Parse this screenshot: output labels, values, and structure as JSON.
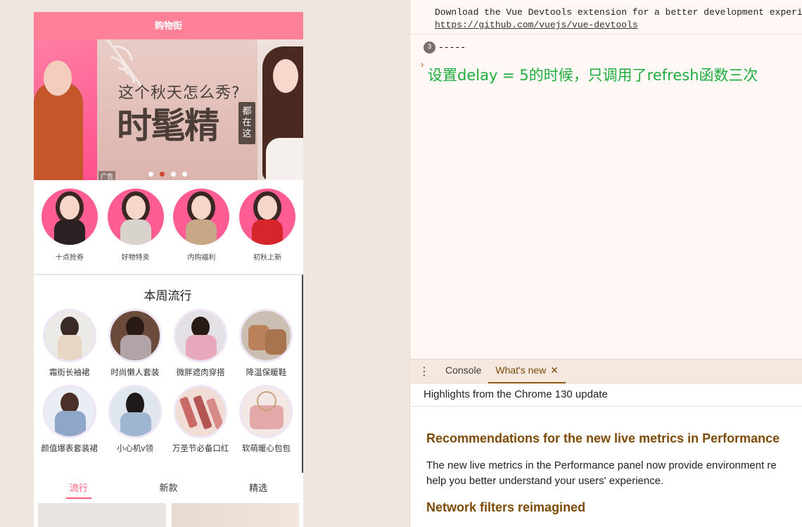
{
  "app": {
    "navbar_title": "购物街",
    "banner": {
      "subtitle": "这个秋天怎么秀?",
      "headline": "时髦精",
      "side_tag": "都在这",
      "ad_label": "广告",
      "active_dot": 2,
      "dot_count": 4
    },
    "recommend": [
      {
        "label": "十点抢券",
        "body": "#2a2222"
      },
      {
        "label": "好物特卖",
        "body": "#d9d3cd"
      },
      {
        "label": "内购福利",
        "body": "#c7a786"
      },
      {
        "label": "初秋上新",
        "body": "#d6262b"
      }
    ],
    "weekly": {
      "title": "本周流行",
      "items": [
        {
          "label": "霜街长袖裙",
          "bg": "#eceae6",
          "fg": "#e8d6c4"
        },
        {
          "label": "时尚懒人套装",
          "bg": "#6a4a3a",
          "fg": "#b2a3a8"
        },
        {
          "label": "微胖遮肉穿搭",
          "bg": "#e3e1e6",
          "fg": "#e7a8bc"
        },
        {
          "label": "降温保暖鞋",
          "bg": "#cbbeb3",
          "fg": "#b9825a"
        },
        {
          "label": "颜值爆表套装裙",
          "bg": "#e9eef4",
          "fg": "#8fa6c9"
        },
        {
          "label": "小心机v领",
          "bg": "#dfe6ee",
          "fg": "#9fb6d1"
        },
        {
          "label": "万圣节必备口红",
          "bg": "#f1dcd6",
          "fg": "#c96a67"
        },
        {
          "label": "软萌暖心包包",
          "bg": "#f3e8e6",
          "fg": "#e3a9a8"
        }
      ]
    },
    "tabs": [
      "流行",
      "新款",
      "精选"
    ],
    "active_tab": 0
  },
  "devtools": {
    "console_message": "Download the Vue Devtools extension for a better development experience:",
    "console_link": "https://github.com/vuejs/vue-devtools",
    "repeat_count": "3",
    "log_text": "-----",
    "annotation": "设置delay = 5的时候，只调用了refresh函数三次",
    "drawer_tabs": [
      "Console",
      "What's new"
    ],
    "active_drawer_tab": 1,
    "highlights": "Highlights from the Chrome 130 update",
    "article": {
      "heading1": "Recommendations for the new live metrics in Performance",
      "paragraph_line1": "The new live metrics in the Performance panel now provide environment re",
      "paragraph_line2": "help you better understand your users' experience.",
      "heading2": "Network filters reimagined"
    }
  }
}
